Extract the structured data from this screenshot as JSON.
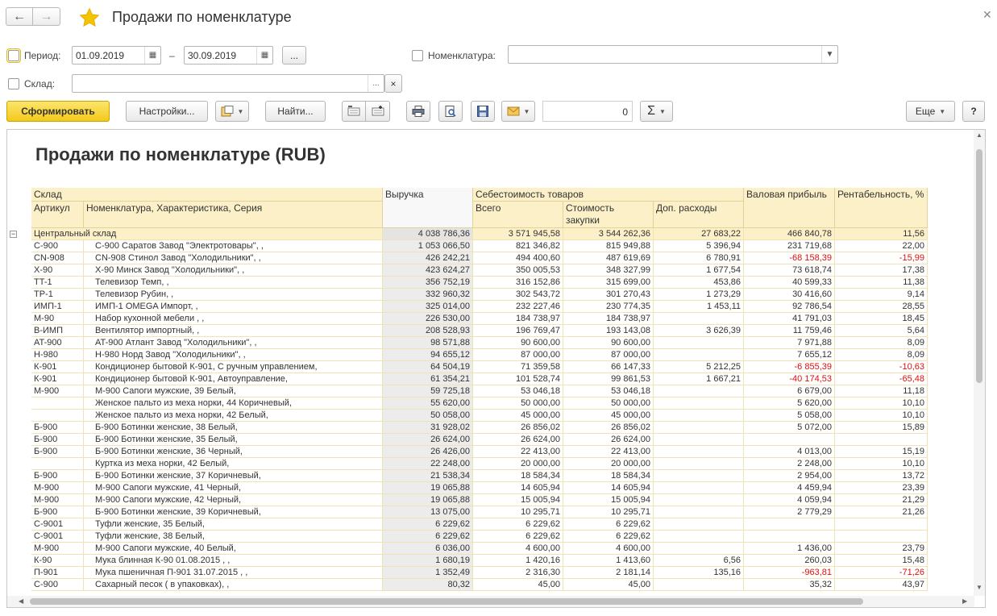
{
  "window": {
    "title": "Продажи по номенклатуре"
  },
  "filters": {
    "period_label": "Период:",
    "date_from": "01.09.2019",
    "date_to": "30.09.2019",
    "dash": "–",
    "more_label": "...",
    "nomenclature_label": "Номенклатура:",
    "nomenclature_value": "",
    "warehouse_label": "Склад:",
    "warehouse_value": "",
    "warehouse_select": "...",
    "warehouse_clear": "×"
  },
  "toolbar": {
    "generate_label": "Сформировать",
    "settings_label": "Настройки...",
    "find_label": "Найти...",
    "counter_value": "0",
    "more_label": "Еще",
    "help_label": "?"
  },
  "report": {
    "title": "Продажи по номенклатуре (RUB)",
    "headers": {
      "warehouse": "Склад",
      "article": "Артикул",
      "nomenclature": "Номенклатура, Характеристика, Серия",
      "revenue": "Выручка",
      "cost_goods": "Себестоимость товаров",
      "total": "Всего",
      "purchase_cost": "Стоимость закупки",
      "extra_costs": "Доп. расходы",
      "gross_profit": "Валовая прибыль",
      "profitability": "Рентабельность, %"
    },
    "group": {
      "name": "Центральный склад",
      "revenue": "4 038 786,36",
      "total": "3 571 945,58",
      "purchase": "3 544 262,36",
      "extra": "27 683,22",
      "profit": "466 840,78",
      "profitability": "11,56"
    },
    "rows": [
      {
        "article": "С-900",
        "name": "С-900 Саратов Завод \"Электротовары\", ,",
        "revenue": "1 053 066,50",
        "total": "821 346,82",
        "purchase": "815 949,88",
        "extra": "5 396,94",
        "profit": "231 719,68",
        "pct": "22,00",
        "neg": false
      },
      {
        "article": "CN-908",
        "name": "CN-908 Стинол Завод \"Холодильники\", ,",
        "revenue": "426 242,21",
        "total": "494 400,60",
        "purchase": "487 619,69",
        "extra": "6 780,91",
        "profit": "-68 158,39",
        "pct": "-15,99",
        "neg": true
      },
      {
        "article": "X-90",
        "name": "X-90 Минск Завод \"Холодильники\", ,",
        "revenue": "423 624,27",
        "total": "350 005,53",
        "purchase": "348 327,99",
        "extra": "1 677,54",
        "profit": "73 618,74",
        "pct": "17,38",
        "neg": false
      },
      {
        "article": "TT-1",
        "name": "Телевизор Темп, ,",
        "revenue": "356 752,19",
        "total": "316 152,86",
        "purchase": "315 699,00",
        "extra": "453,86",
        "profit": "40 599,33",
        "pct": "11,38",
        "neg": false
      },
      {
        "article": "TP-1",
        "name": "Телевизор Рубин, ,",
        "revenue": "332 960,32",
        "total": "302 543,72",
        "purchase": "301 270,43",
        "extra": "1 273,29",
        "profit": "30 416,60",
        "pct": "9,14",
        "neg": false
      },
      {
        "article": "ИМП-1",
        "name": "ИМП-1 OMEGA Импорт, ,",
        "revenue": "325 014,00",
        "total": "232 227,46",
        "purchase": "230 774,35",
        "extra": "1 453,11",
        "profit": "92 786,54",
        "pct": "28,55",
        "neg": false
      },
      {
        "article": "M-90",
        "name": "Набор кухонной мебели , ,",
        "revenue": "226 530,00",
        "total": "184 738,97",
        "purchase": "184 738,97",
        "extra": "",
        "profit": "41 791,03",
        "pct": "18,45",
        "neg": false
      },
      {
        "article": "В-ИМП",
        "name": "Вентилятор импортный, ,",
        "revenue": "208 528,93",
        "total": "196 769,47",
        "purchase": "193 143,08",
        "extra": "3 626,39",
        "profit": "11 759,46",
        "pct": "5,64",
        "neg": false
      },
      {
        "article": "AT-900",
        "name": "AT-900 Атлант Завод \"Холодильники\", ,",
        "revenue": "98 571,88",
        "total": "90 600,00",
        "purchase": "90 600,00",
        "extra": "",
        "profit": "7 971,88",
        "pct": "8,09",
        "neg": false
      },
      {
        "article": "H-980",
        "name": "Н-980 Норд Завод \"Холодильники\", ,",
        "revenue": "94 655,12",
        "total": "87 000,00",
        "purchase": "87 000,00",
        "extra": "",
        "profit": "7 655,12",
        "pct": "8,09",
        "neg": false
      },
      {
        "article": "К-901",
        "name": "Кондиционер бытовой К-901, С ручным управлением,",
        "revenue": "64 504,19",
        "total": "71 359,58",
        "purchase": "66 147,33",
        "extra": "5 212,25",
        "profit": "-6 855,39",
        "pct": "-10,63",
        "neg": true
      },
      {
        "article": "К-901",
        "name": "Кондиционер бытовой К-901, Автоуправление,",
        "revenue": "61 354,21",
        "total": "101 528,74",
        "purchase": "99 861,53",
        "extra": "1 667,21",
        "profit": "-40 174,53",
        "pct": "-65,48",
        "neg": true
      },
      {
        "article": "M-900",
        "name": "М-900 Сапоги мужские, 39 Белый,",
        "revenue": "59 725,18",
        "total": "53 046,18",
        "purchase": "53 046,18",
        "extra": "",
        "profit": "6 679,00",
        "pct": "11,18",
        "neg": false
      },
      {
        "article": "",
        "name": "Женское пальто из меха норки, 44 Коричневый,",
        "revenue": "55 620,00",
        "total": "50 000,00",
        "purchase": "50 000,00",
        "extra": "",
        "profit": "5 620,00",
        "pct": "10,10",
        "neg": false
      },
      {
        "article": "",
        "name": "Женское пальто из меха норки, 42 Белый,",
        "revenue": "50 058,00",
        "total": "45 000,00",
        "purchase": "45 000,00",
        "extra": "",
        "profit": "5 058,00",
        "pct": "10,10",
        "neg": false
      },
      {
        "article": "Б-900",
        "name": "Б-900 Ботинки женские, 38 Белый,",
        "revenue": "31 928,02",
        "total": "26 856,02",
        "purchase": "26 856,02",
        "extra": "",
        "profit": "5 072,00",
        "pct": "15,89",
        "neg": false
      },
      {
        "article": "Б-900",
        "name": "Б-900 Ботинки женские, 35 Белый,",
        "revenue": "26 624,00",
        "total": "26 624,00",
        "purchase": "26 624,00",
        "extra": "",
        "profit": "",
        "pct": "",
        "neg": false
      },
      {
        "article": "Б-900",
        "name": "Б-900 Ботинки женские, 36 Черный,",
        "revenue": "26 426,00",
        "total": "22 413,00",
        "purchase": "22 413,00",
        "extra": "",
        "profit": "4 013,00",
        "pct": "15,19",
        "neg": false
      },
      {
        "article": "",
        "name": "Куртка из меха норки, 42 Белый,",
        "revenue": "22 248,00",
        "total": "20 000,00",
        "purchase": "20 000,00",
        "extra": "",
        "profit": "2 248,00",
        "pct": "10,10",
        "neg": false
      },
      {
        "article": "Б-900",
        "name": "Б-900 Ботинки женские, 37 Коричневый,",
        "revenue": "21 538,34",
        "total": "18 584,34",
        "purchase": "18 584,34",
        "extra": "",
        "profit": "2 954,00",
        "pct": "13,72",
        "neg": false
      },
      {
        "article": "M-900",
        "name": "М-900 Сапоги мужские, 41 Черный,",
        "revenue": "19 065,88",
        "total": "14 605,94",
        "purchase": "14 605,94",
        "extra": "",
        "profit": "4 459,94",
        "pct": "23,39",
        "neg": false
      },
      {
        "article": "M-900",
        "name": "М-900 Сапоги мужские, 42 Черный,",
        "revenue": "19 065,88",
        "total": "15 005,94",
        "purchase": "15 005,94",
        "extra": "",
        "profit": "4 059,94",
        "pct": "21,29",
        "neg": false
      },
      {
        "article": "Б-900",
        "name": "Б-900 Ботинки женские, 39 Коричневый,",
        "revenue": "13 075,00",
        "total": "10 295,71",
        "purchase": "10 295,71",
        "extra": "",
        "profit": "2 779,29",
        "pct": "21,26",
        "neg": false
      },
      {
        "article": "С-9001",
        "name": "Туфли женские, 35 Белый,",
        "revenue": "6 229,62",
        "total": "6 229,62",
        "purchase": "6 229,62",
        "extra": "",
        "profit": "",
        "pct": "",
        "neg": false
      },
      {
        "article": "С-9001",
        "name": "Туфли женские, 38 Белый,",
        "revenue": "6 229,62",
        "total": "6 229,62",
        "purchase": "6 229,62",
        "extra": "",
        "profit": "",
        "pct": "",
        "neg": false
      },
      {
        "article": "M-900",
        "name": "М-900 Сапоги мужские, 40 Белый,",
        "revenue": "6 036,00",
        "total": "4 600,00",
        "purchase": "4 600,00",
        "extra": "",
        "profit": "1 436,00",
        "pct": "23,79",
        "neg": false
      },
      {
        "article": "К-90",
        "name": "Мука блинная  К-90 01.08.2015 , ,",
        "revenue": "1 680,19",
        "total": "1 420,16",
        "purchase": "1 413,60",
        "extra": "6,56",
        "profit": "260,03",
        "pct": "15,48",
        "neg": false
      },
      {
        "article": "П-901",
        "name": "Мука пшеничная П-901  31.07.2015 , ,",
        "revenue": "1 352,49",
        "total": "2 316,30",
        "purchase": "2 181,14",
        "extra": "135,16",
        "profit": "-963,81",
        "pct": "-71,26",
        "neg": true
      },
      {
        "article": "С-900",
        "name": "Сахарный песок ( в упаковках), ,",
        "revenue": "80,32",
        "total": "45,00",
        "purchase": "45,00",
        "extra": "",
        "profit": "35,32",
        "pct": "43,97",
        "neg": false
      }
    ]
  }
}
